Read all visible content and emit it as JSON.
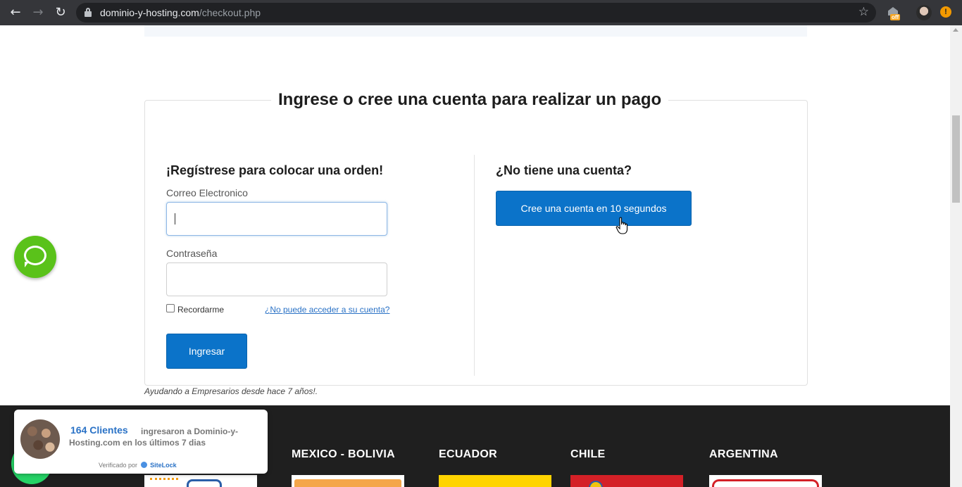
{
  "browser": {
    "url_domain": "dominio-y-hosting.com",
    "url_path": "/checkout.php",
    "extension_badge": "off",
    "alert_badge": "!"
  },
  "login": {
    "heading": "Ingrese o cree una cuenta para realizar un pago",
    "register_title": "¡Regístrese para colocar una orden!",
    "email_label": "Correo Electronico",
    "email_value": "",
    "password_label": "Contraseña",
    "password_value": "",
    "remember_label": "Recordarme",
    "forgot_link": "¿No puede acceder a su cuenta?",
    "submit_label": "Ingresar",
    "no_account_title": "¿No tiene una cuenta?",
    "create_account_label": "Cree una cuenta en 10 segundos"
  },
  "tagline": "Ayudando a Empresarios desde hace 7 años!.",
  "footer": {
    "countries": [
      "MEXICO - BOLIVIA",
      "ECUADOR",
      "CHILE",
      "ARGENTINA"
    ]
  },
  "notification": {
    "count": "164 Clientes",
    "message": "ingresaron a Dominio-y-Hosting.com en los últimos 7 dias",
    "verified_by": "Verificado por",
    "brand": "SiteLock"
  },
  "colors": {
    "primary_button": "#0b73c9",
    "link": "#2a72c6",
    "chat_green": "#5ac21a",
    "footer_bg": "#1f1f1f"
  },
  "icons": [
    "back-arrow-icon",
    "forward-arrow-icon",
    "reload-icon",
    "lock-icon",
    "star-icon",
    "chat-icon",
    "whatsapp-icon",
    "hand-cursor-icon"
  ]
}
